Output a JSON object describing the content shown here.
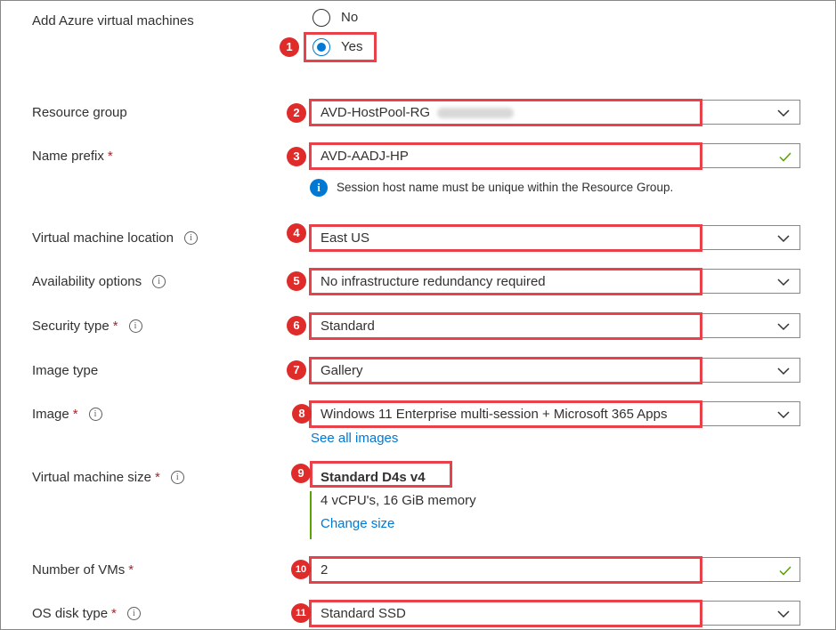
{
  "labels": {
    "add_vms": "Add Azure virtual machines",
    "resource_group": "Resource group",
    "name_prefix": "Name prefix",
    "vm_location": "Virtual machine location",
    "availability": "Availability options",
    "security_type": "Security type",
    "image_type": "Image type",
    "image": "Image",
    "vm_size": "Virtual machine size",
    "num_vms": "Number of VMs",
    "os_disk": "OS disk type"
  },
  "required_marker": "*",
  "add_vms_options": {
    "no": "No",
    "yes": "Yes",
    "selected": "Yes"
  },
  "fields": {
    "resource_group": "AVD-HostPool-RG",
    "name_prefix": "AVD-AADJ-HP",
    "vm_location": "East US",
    "availability": "No infrastructure redundancy required",
    "security_type": "Standard",
    "image_type": "Gallery",
    "image": "Windows 11 Enterprise multi-session + Microsoft 365 Apps",
    "num_vms": "2",
    "os_disk": "Standard SSD"
  },
  "name_prefix_note": "Session host name must be unique within the Resource Group.",
  "see_all_images": "See all images",
  "vm_size": {
    "name": "Standard D4s v4",
    "details": "4 vCPU's, 16 GiB memory",
    "change": "Change size"
  },
  "badges": [
    "1",
    "2",
    "3",
    "4",
    "5",
    "6",
    "7",
    "8",
    "9",
    "10",
    "11"
  ],
  "colors": {
    "accent": "#0078d4",
    "highlight": "#e8414a",
    "badge": "#e02b2b",
    "valid": "#57a300"
  }
}
